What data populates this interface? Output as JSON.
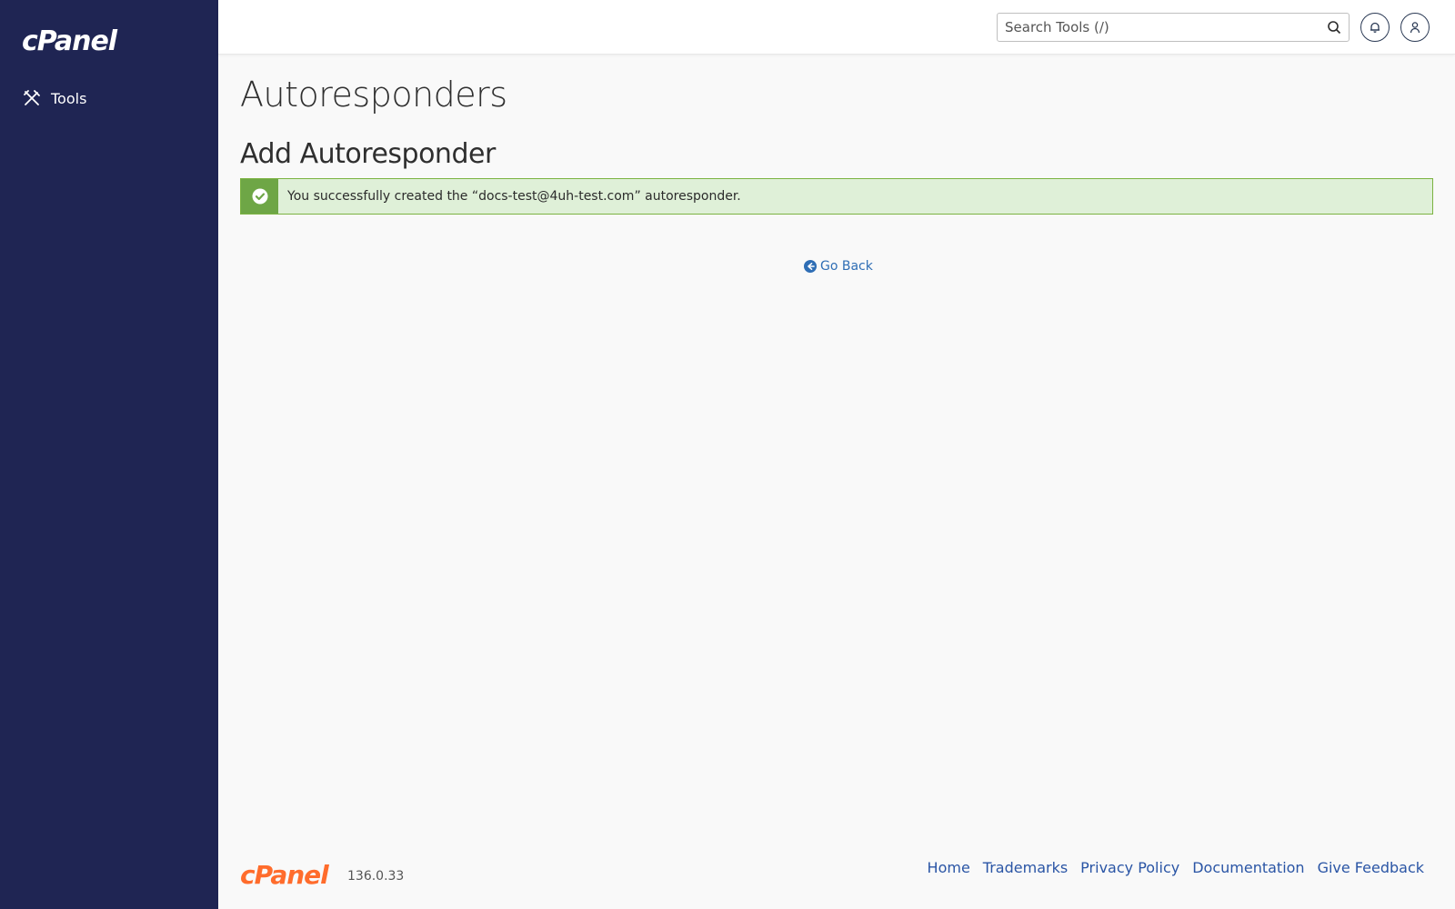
{
  "app": {
    "logo_text": "cPanel",
    "brand_color": "#1f2553",
    "accent_color": "#ff6c2c"
  },
  "sidebar": {
    "items": [
      {
        "label": "Tools",
        "icon": "tools-icon"
      }
    ]
  },
  "header": {
    "search": {
      "placeholder": "Search Tools (/)",
      "value": ""
    },
    "icons": [
      "bell-icon",
      "user-icon"
    ]
  },
  "main": {
    "page_title": "Autoresponders",
    "section_title": "Add Autoresponder",
    "alert": {
      "type": "success",
      "message": "You successfully created the “docs-test@4uh-test.com” autoresponder.",
      "icon": "check-circle-icon",
      "color": "#6ea646"
    },
    "go_back_label": "Go Back"
  },
  "footer": {
    "logo_text": "cPanel",
    "version": "136.0.33",
    "links": [
      "Home",
      "Trademarks",
      "Privacy Policy",
      "Documentation",
      "Give Feedback"
    ]
  }
}
